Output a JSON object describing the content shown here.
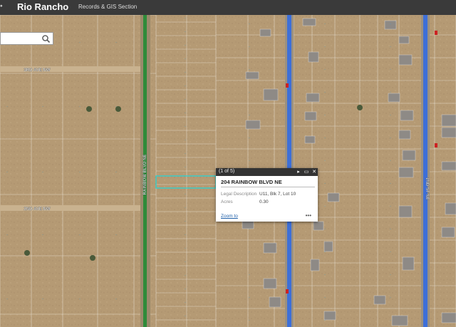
{
  "header": {
    "title": "Rio Rancho",
    "subtitle": "Records & GIS Section"
  },
  "search": {
    "value": "",
    "placeholder": ""
  },
  "map": {
    "streets": [
      {
        "label": "3RD AVE NW"
      },
      {
        "label": "2ND AVE NW"
      },
      {
        "label": "RAINBOW BLVD NE"
      },
      {
        "label": "2ND ST NE"
      }
    ],
    "colors": {
      "parcel_line": "#e8e2d6",
      "road_blue": "#3d6fd8",
      "road_green": "#2e8b3a",
      "label": "#2a9fd6",
      "selected_parcel": "#29d3d3"
    }
  },
  "popup": {
    "counter": "(1 of 5)",
    "title": "204 RAINBOW BLVD NE",
    "fields": [
      {
        "key": "Legal Description",
        "value": "U11, Blk 7, Lot 10"
      },
      {
        "key": "Acres",
        "value": "0.30"
      }
    ],
    "zoom_label": "Zoom to",
    "more_glyph": "•••",
    "next_glyph": "▸",
    "max_glyph": "▭",
    "close_glyph": "✕"
  },
  "icons": {
    "search": "search-icon",
    "next": "next-feature-icon",
    "maximize": "maximize-icon",
    "close": "close-icon"
  }
}
